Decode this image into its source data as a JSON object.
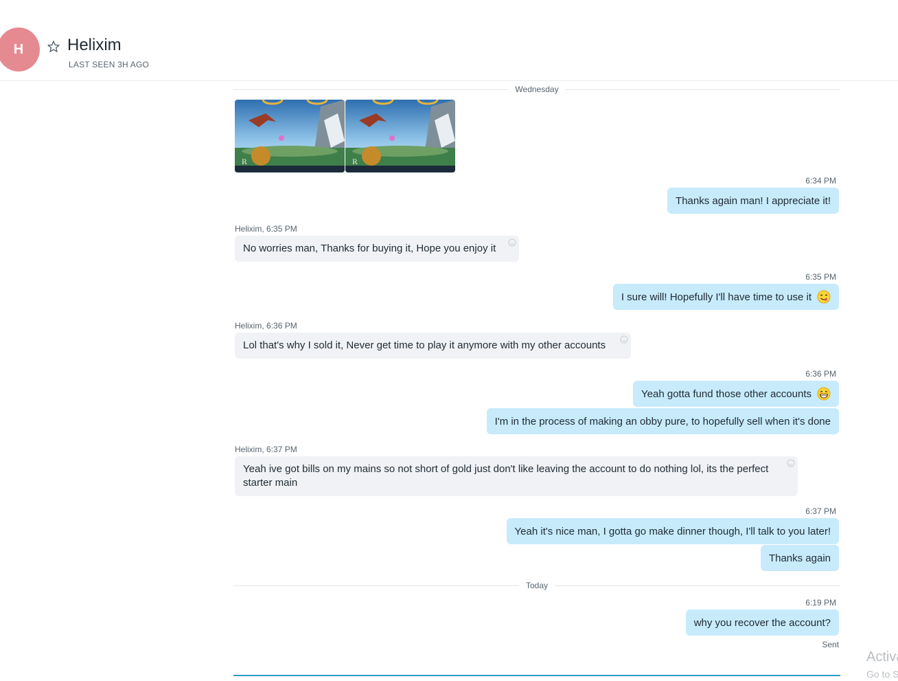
{
  "header": {
    "avatar_letter": "H",
    "name": "Helixim",
    "status": "LAST SEEN 3H AGO"
  },
  "dividers": {
    "wednesday": "Wednesday",
    "today": "Today"
  },
  "images": {
    "count": 2,
    "watermark_letter": "R"
  },
  "messages": [
    {
      "time": "6:34 PM",
      "text": "Thanks again man! I appreciate it!"
    },
    {
      "sender": "Helixim",
      "time": "6:35 PM",
      "text": "No worries man, Thanks for buying it, Hope you enjoy it"
    },
    {
      "time": "6:35 PM",
      "text": "I sure will! Hopefully I'll have time to use it"
    },
    {
      "sender": "Helixim",
      "time": "6:36 PM",
      "text": "Lol that's why I sold it, Never get time to play it anymore with my other accounts"
    },
    {
      "time": "6:36 PM",
      "text": "Yeah gotta fund those other accounts"
    },
    {
      "text": "I'm in the process of making an obby pure, to hopefully sell when it's done"
    },
    {
      "sender": "Helixim",
      "time": "6:37 PM",
      "text": "Yeah ive got bills on my mains so not short of gold just don't like leaving the account to do nothing lol, its the perfect starter main"
    },
    {
      "time": "6:37 PM",
      "text": "Yeah it's nice man, I gotta go make dinner though, I'll talk to you later!"
    },
    {
      "text": "Thanks again"
    },
    {
      "time": "6:19 PM",
      "text": "why you recover the account?"
    }
  ],
  "sent_status": "Sent",
  "watermark": {
    "line1": "Activa",
    "line2": "Go to S"
  },
  "colors": {
    "avatar": "#e58a91",
    "outgoing_bubble": "#c7ebfb",
    "incoming_bubble": "#f0f2f5",
    "accent_line": "#2b9cc8"
  }
}
